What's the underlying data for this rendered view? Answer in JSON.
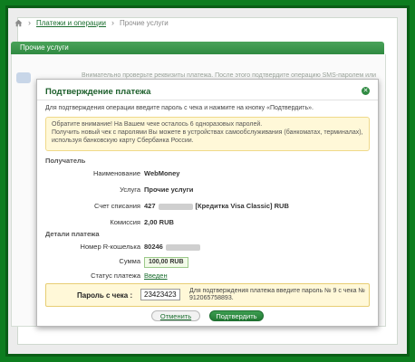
{
  "breadcrumb": {
    "home_icon": "home-icon",
    "link": "Платежи и операции",
    "current": "Прочие услуги"
  },
  "panel": {
    "title": "Прочие услуги",
    "background_text": "Внимательно проверьте реквизиты платежа. После этого подтвердите операцию SMS-паролем или"
  },
  "dialog": {
    "title": "Подтверждение платежа",
    "close_icon": "close-icon",
    "instruction": "Для подтверждения операции введите пароль с чека и нажмите на кнопку «Подтвердить».",
    "notice_line1": "Обратите внимание! На Вашем чеке осталось 6 одноразовых паролей.",
    "notice_line2": "Получить новый чек с паролями Вы можете в устройствах самообслуживания (банкоматах, терминалах),",
    "notice_line3": "используя банковскую карту Сбербанка России.",
    "recipient_section": "Получатель",
    "fields": {
      "name_label": "Наименование",
      "name_value": "WebMoney",
      "service_label": "Услуга",
      "service_value": "Прочие услуги",
      "account_label": "Счет списания",
      "account_prefix": "427",
      "account_suffix": "[Кредитка Visa Classic]  RUB",
      "fee_label": "Комиссия",
      "fee_value": "2,00 RUB"
    },
    "details_section": "Детали платежа",
    "details": {
      "wallet_label": "Номер R-кошелька",
      "wallet_prefix": "80246",
      "amount_label": "Сумма",
      "amount_value": "100,00 RUB",
      "status_label": "Статус платежа",
      "status_value": "Введен"
    },
    "password": {
      "label": "Пароль с чека :",
      "value": "23423423",
      "hint": "Для подтверждения платежа введите пароль № 9 с чека № 912065758893."
    },
    "buttons": {
      "cancel": "Отменить",
      "confirm": "Подтвердить"
    }
  },
  "colors": {
    "background": "#0d7d1f",
    "accent": "#2f8a41",
    "notice_bg": "#fff8d8"
  }
}
